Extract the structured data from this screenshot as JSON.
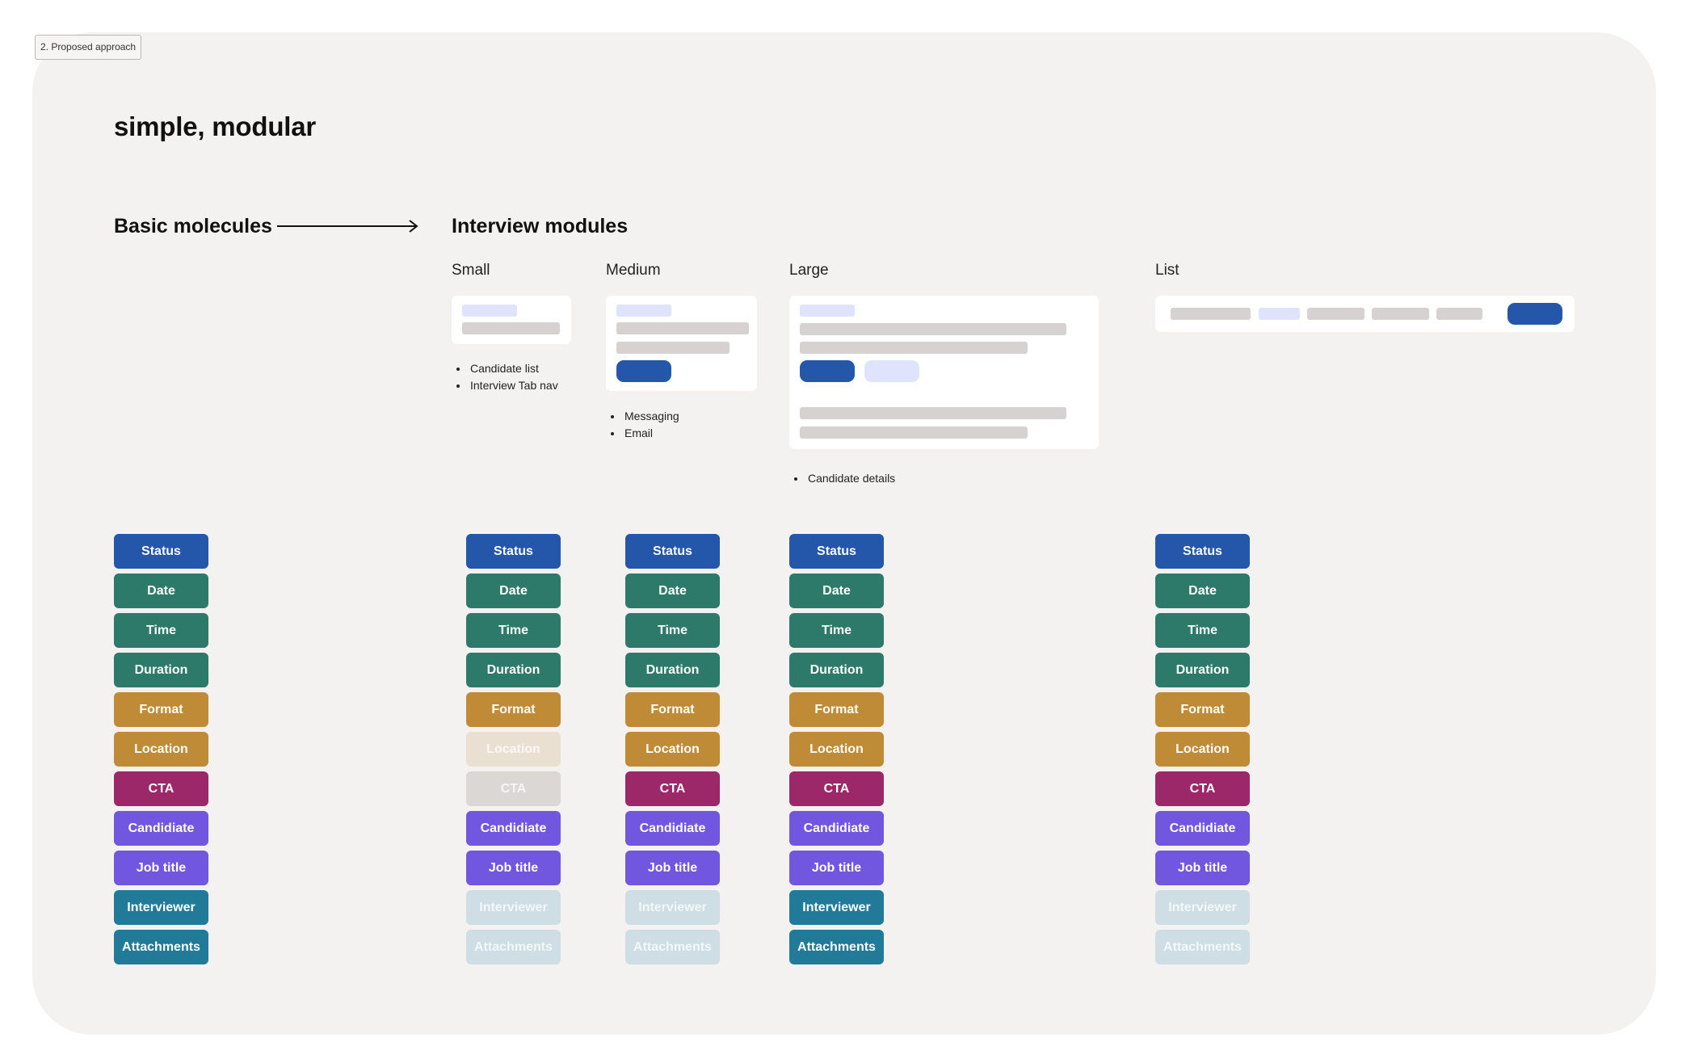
{
  "frame_label": "2. Proposed approach",
  "title": "simple, modular",
  "sections": {
    "basic": "Basic molecules",
    "interview": "Interview modules"
  },
  "modules": {
    "small": {
      "label": "Small",
      "uses": [
        "Candidate list",
        "Interview Tab nav"
      ]
    },
    "medium": {
      "label": "Medium",
      "uses": [
        "Messaging",
        "Email"
      ]
    },
    "large": {
      "label": "Large",
      "uses": [
        "Candidate details"
      ]
    },
    "list": {
      "label": "List"
    }
  },
  "colors": {
    "status": "#2456aa",
    "green": "#2d7a6a",
    "amber": "#c08b36",
    "cta": "#9c2769",
    "purple": "#7157e0",
    "teal": "#217a98",
    "faded_amber": "#eae0d2",
    "faded_gray": "#dad7d5",
    "faded_teal": "#cfdde4"
  },
  "molecules": [
    "Status",
    "Date",
    "Time",
    "Duration",
    "Format",
    "Location",
    "CTA",
    "Candidiate",
    "Job title",
    "Interviewer",
    "Attachments"
  ],
  "columns": {
    "basic": {
      "faded": []
    },
    "small": {
      "faded": [
        "Location",
        "CTA",
        "Interviewer",
        "Attachments"
      ]
    },
    "medium": {
      "faded": [
        "Interviewer",
        "Attachments"
      ]
    },
    "large": {
      "faded": []
    },
    "list": {
      "faded": [
        "Interviewer",
        "Attachments"
      ]
    }
  }
}
